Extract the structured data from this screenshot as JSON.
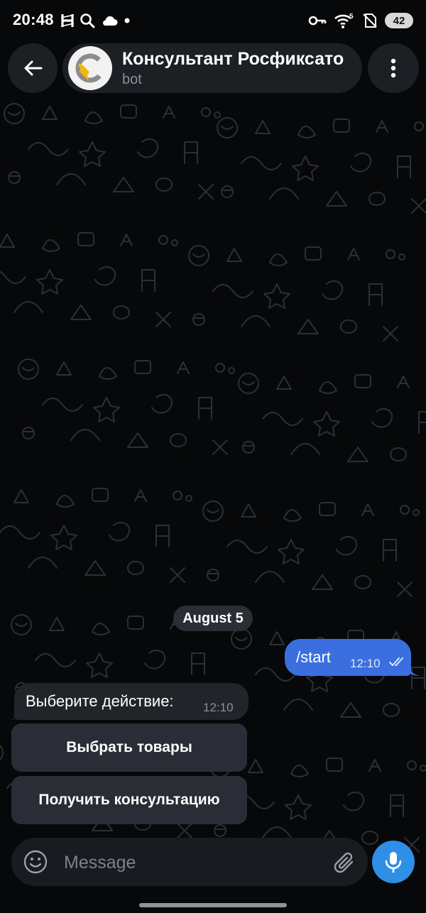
{
  "status_bar": {
    "time": "20:48",
    "left_icons": [
      "h-icon",
      "search-icon",
      "cloud-icon",
      "dot-icon"
    ],
    "right_icons": [
      "key-icon",
      "wifi-icon",
      "sim-off-icon"
    ],
    "wifi_badge": "5",
    "battery": "42"
  },
  "header": {
    "title": "Консультант Росфиксато",
    "subtitle": "bot",
    "avatar_colors": {
      "ring": "#8c8c8c",
      "arrow": "#f2b705"
    }
  },
  "chat": {
    "date_chip": "August 5",
    "outgoing": {
      "text": "/start",
      "time": "12:10",
      "status": "read"
    },
    "incoming": {
      "text": "Выберите действие:",
      "time": "12:10"
    },
    "keyboard_buttons": [
      "Выбрать товары",
      "Получить консультацию"
    ]
  },
  "input": {
    "placeholder": "Message",
    "value": ""
  },
  "colors": {
    "background": "#070809",
    "outgoing_bubble": "#3b6fe0",
    "incoming_bubble": "#212429",
    "mic_button": "#2f8ee6"
  }
}
